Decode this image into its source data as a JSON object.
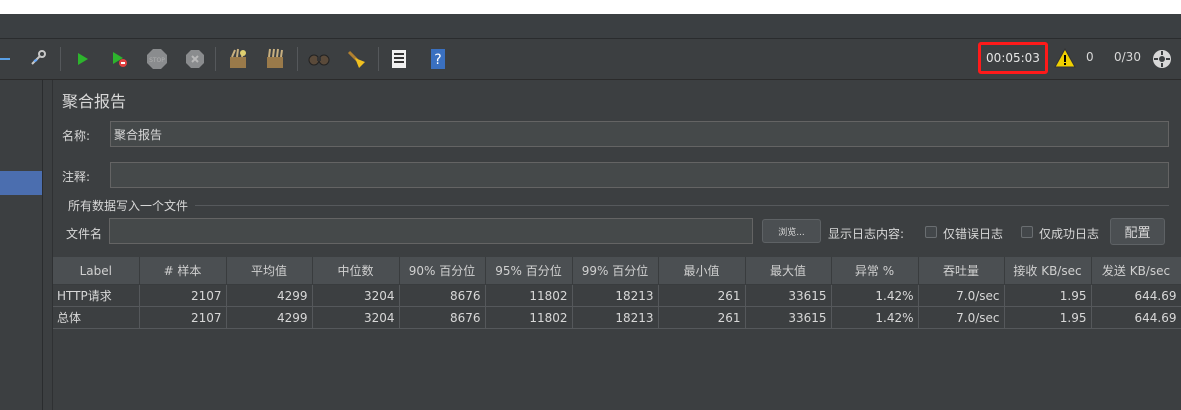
{
  "toolbar": {
    "icons": [
      "minus-icon",
      "wrench-icon",
      "start-icon",
      "start-no-pause-icon",
      "stop-icon",
      "shutdown-icon",
      "clear-icon",
      "clear-all-icon",
      "search-icon",
      "reset-search-icon",
      "function-helper-icon",
      "help-icon",
      "remote-icon"
    ],
    "timer": "00:05:03",
    "warning_count": "0",
    "threads": "0/30",
    "colors": {
      "timer_highlight": "#ff1a1a",
      "start": "#2db42d",
      "selection": "#4b6eaf"
    }
  },
  "panel": {
    "title": "聚合报告",
    "name_label": "名称:",
    "name_value": "聚合报告",
    "comment_label": "注释:",
    "comment_value": "",
    "file_group_title": "所有数据写入一个文件",
    "filename_label": "文件名",
    "filename_value": "",
    "browse_label": "浏览...",
    "log_display_label": "显示日志内容:",
    "errors_only_label": "仅错误日志",
    "success_only_label": "仅成功日志",
    "configure_label": "配置"
  },
  "table": {
    "headers": [
      "Label",
      "# 样本",
      "平均值",
      "中位数",
      "90% 百分位",
      "95% 百分位",
      "99% 百分位",
      "最小值",
      "最大值",
      "异常 %",
      "吞吐量",
      "接收 KB/sec",
      "发送 KB/sec"
    ],
    "rows": [
      [
        "HTTP请求",
        "2107",
        "4299",
        "3204",
        "8676",
        "11802",
        "18213",
        "261",
        "33615",
        "1.42%",
        "7.0/sec",
        "1.95",
        "644.69"
      ],
      [
        "总体",
        "2107",
        "4299",
        "3204",
        "8676",
        "11802",
        "18213",
        "261",
        "33615",
        "1.42%",
        "7.0/sec",
        "1.95",
        "644.69"
      ]
    ]
  }
}
